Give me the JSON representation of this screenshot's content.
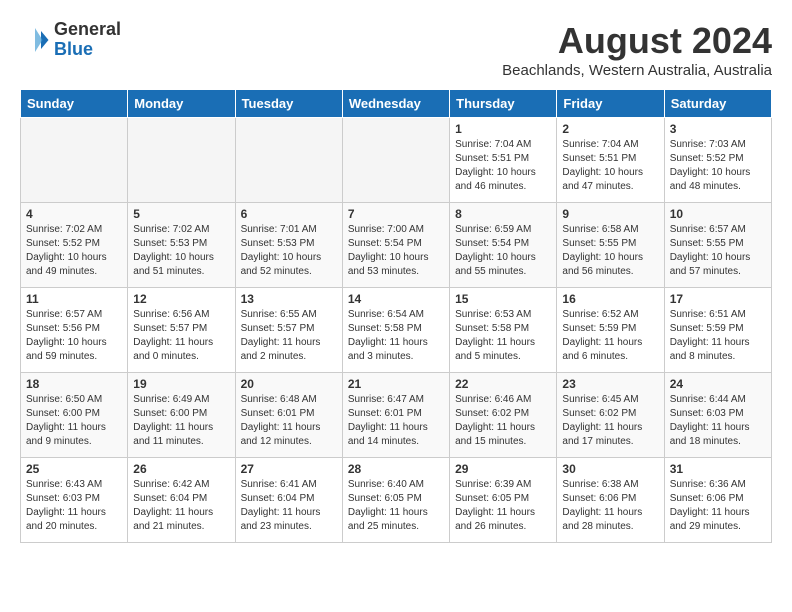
{
  "header": {
    "logo_line1": "General",
    "logo_line2": "Blue",
    "month_year": "August 2024",
    "location": "Beachlands, Western Australia, Australia"
  },
  "weekdays": [
    "Sunday",
    "Monday",
    "Tuesday",
    "Wednesday",
    "Thursday",
    "Friday",
    "Saturday"
  ],
  "weeks": [
    [
      {
        "day": "",
        "info": ""
      },
      {
        "day": "",
        "info": ""
      },
      {
        "day": "",
        "info": ""
      },
      {
        "day": "",
        "info": ""
      },
      {
        "day": "1",
        "info": "Sunrise: 7:04 AM\nSunset: 5:51 PM\nDaylight: 10 hours\nand 46 minutes."
      },
      {
        "day": "2",
        "info": "Sunrise: 7:04 AM\nSunset: 5:51 PM\nDaylight: 10 hours\nand 47 minutes."
      },
      {
        "day": "3",
        "info": "Sunrise: 7:03 AM\nSunset: 5:52 PM\nDaylight: 10 hours\nand 48 minutes."
      }
    ],
    [
      {
        "day": "4",
        "info": "Sunrise: 7:02 AM\nSunset: 5:52 PM\nDaylight: 10 hours\nand 49 minutes."
      },
      {
        "day": "5",
        "info": "Sunrise: 7:02 AM\nSunset: 5:53 PM\nDaylight: 10 hours\nand 51 minutes."
      },
      {
        "day": "6",
        "info": "Sunrise: 7:01 AM\nSunset: 5:53 PM\nDaylight: 10 hours\nand 52 minutes."
      },
      {
        "day": "7",
        "info": "Sunrise: 7:00 AM\nSunset: 5:54 PM\nDaylight: 10 hours\nand 53 minutes."
      },
      {
        "day": "8",
        "info": "Sunrise: 6:59 AM\nSunset: 5:54 PM\nDaylight: 10 hours\nand 55 minutes."
      },
      {
        "day": "9",
        "info": "Sunrise: 6:58 AM\nSunset: 5:55 PM\nDaylight: 10 hours\nand 56 minutes."
      },
      {
        "day": "10",
        "info": "Sunrise: 6:57 AM\nSunset: 5:55 PM\nDaylight: 10 hours\nand 57 minutes."
      }
    ],
    [
      {
        "day": "11",
        "info": "Sunrise: 6:57 AM\nSunset: 5:56 PM\nDaylight: 10 hours\nand 59 minutes."
      },
      {
        "day": "12",
        "info": "Sunrise: 6:56 AM\nSunset: 5:57 PM\nDaylight: 11 hours\nand 0 minutes."
      },
      {
        "day": "13",
        "info": "Sunrise: 6:55 AM\nSunset: 5:57 PM\nDaylight: 11 hours\nand 2 minutes."
      },
      {
        "day": "14",
        "info": "Sunrise: 6:54 AM\nSunset: 5:58 PM\nDaylight: 11 hours\nand 3 minutes."
      },
      {
        "day": "15",
        "info": "Sunrise: 6:53 AM\nSunset: 5:58 PM\nDaylight: 11 hours\nand 5 minutes."
      },
      {
        "day": "16",
        "info": "Sunrise: 6:52 AM\nSunset: 5:59 PM\nDaylight: 11 hours\nand 6 minutes."
      },
      {
        "day": "17",
        "info": "Sunrise: 6:51 AM\nSunset: 5:59 PM\nDaylight: 11 hours\nand 8 minutes."
      }
    ],
    [
      {
        "day": "18",
        "info": "Sunrise: 6:50 AM\nSunset: 6:00 PM\nDaylight: 11 hours\nand 9 minutes."
      },
      {
        "day": "19",
        "info": "Sunrise: 6:49 AM\nSunset: 6:00 PM\nDaylight: 11 hours\nand 11 minutes."
      },
      {
        "day": "20",
        "info": "Sunrise: 6:48 AM\nSunset: 6:01 PM\nDaylight: 11 hours\nand 12 minutes."
      },
      {
        "day": "21",
        "info": "Sunrise: 6:47 AM\nSunset: 6:01 PM\nDaylight: 11 hours\nand 14 minutes."
      },
      {
        "day": "22",
        "info": "Sunrise: 6:46 AM\nSunset: 6:02 PM\nDaylight: 11 hours\nand 15 minutes."
      },
      {
        "day": "23",
        "info": "Sunrise: 6:45 AM\nSunset: 6:02 PM\nDaylight: 11 hours\nand 17 minutes."
      },
      {
        "day": "24",
        "info": "Sunrise: 6:44 AM\nSunset: 6:03 PM\nDaylight: 11 hours\nand 18 minutes."
      }
    ],
    [
      {
        "day": "25",
        "info": "Sunrise: 6:43 AM\nSunset: 6:03 PM\nDaylight: 11 hours\nand 20 minutes."
      },
      {
        "day": "26",
        "info": "Sunrise: 6:42 AM\nSunset: 6:04 PM\nDaylight: 11 hours\nand 21 minutes."
      },
      {
        "day": "27",
        "info": "Sunrise: 6:41 AM\nSunset: 6:04 PM\nDaylight: 11 hours\nand 23 minutes."
      },
      {
        "day": "28",
        "info": "Sunrise: 6:40 AM\nSunset: 6:05 PM\nDaylight: 11 hours\nand 25 minutes."
      },
      {
        "day": "29",
        "info": "Sunrise: 6:39 AM\nSunset: 6:05 PM\nDaylight: 11 hours\nand 26 minutes."
      },
      {
        "day": "30",
        "info": "Sunrise: 6:38 AM\nSunset: 6:06 PM\nDaylight: 11 hours\nand 28 minutes."
      },
      {
        "day": "31",
        "info": "Sunrise: 6:36 AM\nSunset: 6:06 PM\nDaylight: 11 hours\nand 29 minutes."
      }
    ]
  ]
}
